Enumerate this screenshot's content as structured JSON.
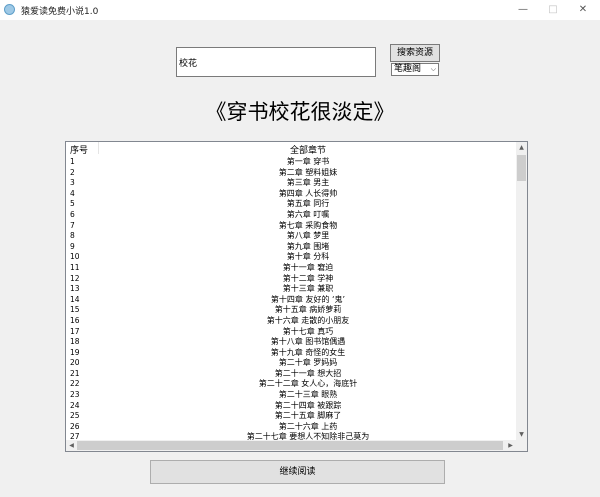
{
  "window": {
    "title": "猿爱读免费小说1.0",
    "icon": "app-icon",
    "controls": {
      "minimize": "—",
      "maximize": "□",
      "close": "✕"
    }
  },
  "search": {
    "value": "校花",
    "button_label": "搜索资源"
  },
  "source": {
    "selected": "笔趣阁",
    "chevron": "⌵"
  },
  "book": {
    "title": "《穿书校花很淡定》"
  },
  "list": {
    "header_no": "序号",
    "header_chapters": "全部章节",
    "rows": [
      {
        "no": "1",
        "chapter": "第一章 穿书"
      },
      {
        "no": "2",
        "chapter": "第二章 塑料姐妹"
      },
      {
        "no": "3",
        "chapter": "第三章 男主"
      },
      {
        "no": "4",
        "chapter": "第四章 人长得帅"
      },
      {
        "no": "5",
        "chapter": "第五章 同行"
      },
      {
        "no": "6",
        "chapter": "第六章 叮嘱"
      },
      {
        "no": "7",
        "chapter": "第七章 采购食物"
      },
      {
        "no": "8",
        "chapter": "第八章 梦里"
      },
      {
        "no": "9",
        "chapter": "第九章 围堵"
      },
      {
        "no": "10",
        "chapter": "第十章 分科"
      },
      {
        "no": "11",
        "chapter": "第十一章 窘迫"
      },
      {
        "no": "12",
        "chapter": "第十二章 学神"
      },
      {
        "no": "13",
        "chapter": "第十三章 兼职"
      },
      {
        "no": "14",
        "chapter": "第十四章 友好的 ‘鬼’"
      },
      {
        "no": "15",
        "chapter": "第十五章 病娇萝莉"
      },
      {
        "no": "16",
        "chapter": "第十六章 走散的小朋友"
      },
      {
        "no": "17",
        "chapter": "第十七章 真巧"
      },
      {
        "no": "18",
        "chapter": "第十八章 图书馆偶遇"
      },
      {
        "no": "19",
        "chapter": "第十九章 奇怪的女生"
      },
      {
        "no": "20",
        "chapter": "第二十章 罗妈妈"
      },
      {
        "no": "21",
        "chapter": "第二十一章 想大招"
      },
      {
        "no": "22",
        "chapter": "第二十二章 女人心，海底针"
      },
      {
        "no": "23",
        "chapter": "第二十三章 眼熟"
      },
      {
        "no": "24",
        "chapter": "第二十四章 被跟踪"
      },
      {
        "no": "25",
        "chapter": "第二十五章 脚麻了"
      },
      {
        "no": "26",
        "chapter": "第二十六章 上药"
      },
      {
        "no": "27",
        "chapter": "第二十七章 要想人不知除非己莫为"
      }
    ]
  },
  "scroll": {
    "up": "▲",
    "down": "▼",
    "left": "◀",
    "right": "▶"
  },
  "continue_label": "继续阅读"
}
